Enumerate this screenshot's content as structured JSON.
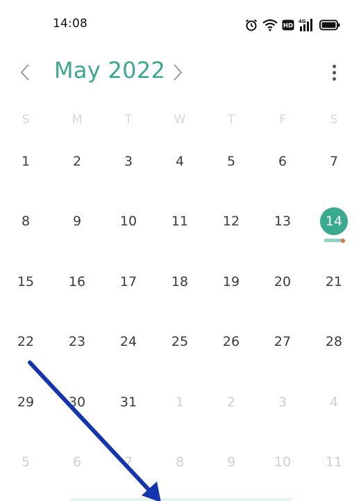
{
  "status_bar": {
    "time": "14:08",
    "icons": [
      "alarm-icon",
      "wifi-icon",
      "hd-icon",
      "signal-4g-icon",
      "battery-icon"
    ],
    "hd_label": "HD",
    "network_label": "4G"
  },
  "header": {
    "title": "May 2022",
    "prev_icon": "chevron-left-icon",
    "next_icon": "chevron-right-icon",
    "more_icon": "more-vertical-icon"
  },
  "weekdays": [
    "S",
    "M",
    "T",
    "W",
    "T",
    "F",
    "S"
  ],
  "weeks": [
    [
      "1",
      "2",
      "3",
      "4",
      "5",
      "6",
      "7"
    ],
    [
      "8",
      "9",
      "10",
      "11",
      "12",
      "13",
      "14"
    ],
    [
      "15",
      "16",
      "17",
      "18",
      "19",
      "20",
      "21"
    ],
    [
      "22",
      "23",
      "24",
      "25",
      "26",
      "27",
      "28"
    ],
    [
      "29",
      "30",
      "31",
      "1",
      "2",
      "3",
      "4"
    ],
    [
      "5",
      "6",
      "7",
      "8",
      "9",
      "10",
      "11"
    ]
  ],
  "today": "14",
  "colors": {
    "accent": "#3aa88d",
    "today_fill": "#3aaa8f",
    "event_bar": "#8fd3c0",
    "event_dot": "#d9713e",
    "annotation_arrow": "#1535b0"
  }
}
